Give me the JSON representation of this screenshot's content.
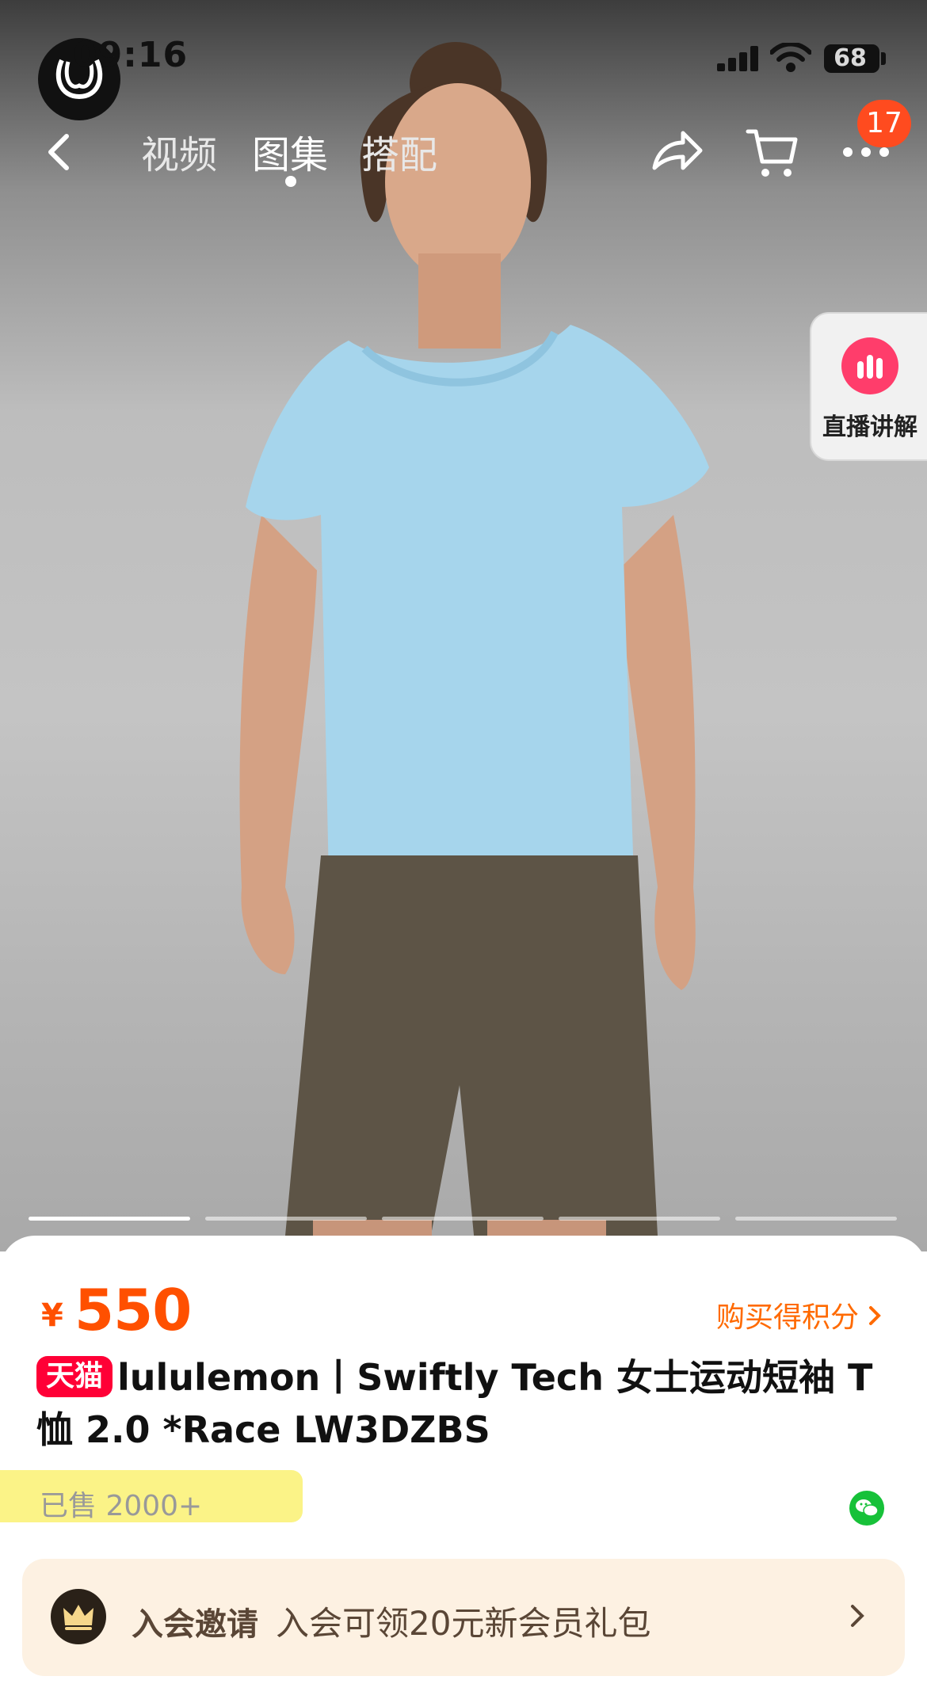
{
  "status_bar": {
    "time": "09:16",
    "battery": "68",
    "icons": [
      "signal-icon",
      "wifi-icon",
      "battery-icon"
    ]
  },
  "brand": {
    "logo": "lululemon-logo"
  },
  "top_nav": {
    "tabs": [
      {
        "label": "视频",
        "active": false
      },
      {
        "label": "图集",
        "active": true
      },
      {
        "label": "搭配",
        "active": false
      }
    ],
    "icons": [
      "back-arrow-icon",
      "share-icon",
      "cart-icon",
      "more-icon"
    ],
    "more_badge": "17"
  },
  "live": {
    "label": "直播讲解",
    "icon": "live-bars-icon",
    "accent": "#ff3d6b"
  },
  "carousel": {
    "count": 5,
    "active_index": 0
  },
  "price": {
    "currency": "¥",
    "value": "550",
    "color": "#ff5000",
    "points_link": "购买得积分"
  },
  "product": {
    "badge": "天猫",
    "badge_color": "#ff0036",
    "title": "lululemon丨Swiftly Tech 女士运动短袖 T 恤 2.0 *Race LW3DZBS",
    "sold": "已售 2000+"
  },
  "member": {
    "invite_label": "入会邀请",
    "offer": "入会可领20元新会员礼包",
    "icon": "crown-icon"
  }
}
